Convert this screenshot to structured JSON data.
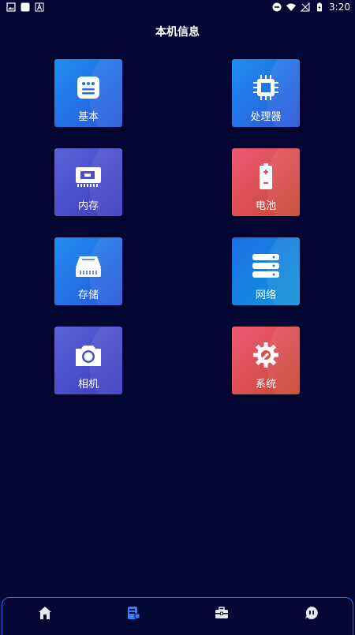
{
  "status": {
    "time": "3:20"
  },
  "title": "本机信息",
  "tiles": [
    {
      "label": "基本",
      "icon": "basic-info-icon"
    },
    {
      "label": "处理器",
      "icon": "cpu-icon"
    },
    {
      "label": "内存",
      "icon": "memory-icon"
    },
    {
      "label": "电池",
      "icon": "battery-icon"
    },
    {
      "label": "存储",
      "icon": "storage-icon"
    },
    {
      "label": "网络",
      "icon": "network-icon"
    },
    {
      "label": "相机",
      "icon": "camera-icon"
    },
    {
      "label": "系统",
      "icon": "system-settings-icon"
    }
  ],
  "nav": [
    "home-icon",
    "device-info-icon",
    "toolbox-icon",
    "chat-icon"
  ],
  "colors": {
    "background": "#040633",
    "accent": "#2f6fe8",
    "nav_active": "#3a7ff2",
    "nav_inactive": "#e8e8f0"
  }
}
